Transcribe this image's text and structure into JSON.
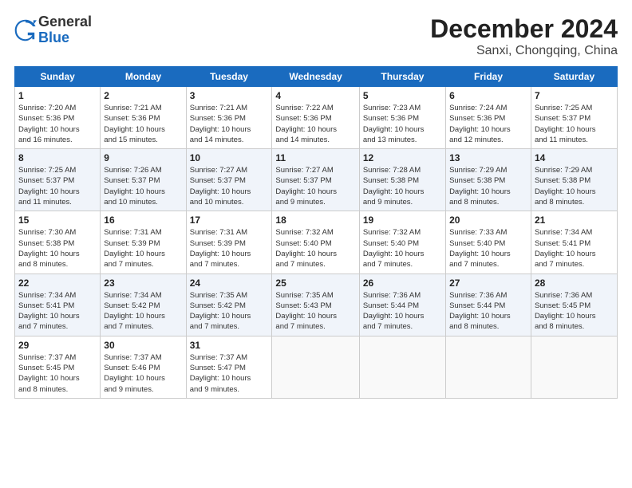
{
  "header": {
    "logo_general": "General",
    "logo_blue": "Blue",
    "main_title": "December 2024",
    "subtitle": "Sanxi, Chongqing, China"
  },
  "weekdays": [
    "Sunday",
    "Monday",
    "Tuesday",
    "Wednesday",
    "Thursday",
    "Friday",
    "Saturday"
  ],
  "weeks": [
    [
      {
        "day": "1",
        "info": "Sunrise: 7:20 AM\nSunset: 5:36 PM\nDaylight: 10 hours\nand 16 minutes."
      },
      {
        "day": "2",
        "info": "Sunrise: 7:21 AM\nSunset: 5:36 PM\nDaylight: 10 hours\nand 15 minutes."
      },
      {
        "day": "3",
        "info": "Sunrise: 7:21 AM\nSunset: 5:36 PM\nDaylight: 10 hours\nand 14 minutes."
      },
      {
        "day": "4",
        "info": "Sunrise: 7:22 AM\nSunset: 5:36 PM\nDaylight: 10 hours\nand 14 minutes."
      },
      {
        "day": "5",
        "info": "Sunrise: 7:23 AM\nSunset: 5:36 PM\nDaylight: 10 hours\nand 13 minutes."
      },
      {
        "day": "6",
        "info": "Sunrise: 7:24 AM\nSunset: 5:36 PM\nDaylight: 10 hours\nand 12 minutes."
      },
      {
        "day": "7",
        "info": "Sunrise: 7:25 AM\nSunset: 5:37 PM\nDaylight: 10 hours\nand 11 minutes."
      }
    ],
    [
      {
        "day": "8",
        "info": "Sunrise: 7:25 AM\nSunset: 5:37 PM\nDaylight: 10 hours\nand 11 minutes."
      },
      {
        "day": "9",
        "info": "Sunrise: 7:26 AM\nSunset: 5:37 PM\nDaylight: 10 hours\nand 10 minutes."
      },
      {
        "day": "10",
        "info": "Sunrise: 7:27 AM\nSunset: 5:37 PM\nDaylight: 10 hours\nand 10 minutes."
      },
      {
        "day": "11",
        "info": "Sunrise: 7:27 AM\nSunset: 5:37 PM\nDaylight: 10 hours\nand 9 minutes."
      },
      {
        "day": "12",
        "info": "Sunrise: 7:28 AM\nSunset: 5:38 PM\nDaylight: 10 hours\nand 9 minutes."
      },
      {
        "day": "13",
        "info": "Sunrise: 7:29 AM\nSunset: 5:38 PM\nDaylight: 10 hours\nand 8 minutes."
      },
      {
        "day": "14",
        "info": "Sunrise: 7:29 AM\nSunset: 5:38 PM\nDaylight: 10 hours\nand 8 minutes."
      }
    ],
    [
      {
        "day": "15",
        "info": "Sunrise: 7:30 AM\nSunset: 5:38 PM\nDaylight: 10 hours\nand 8 minutes."
      },
      {
        "day": "16",
        "info": "Sunrise: 7:31 AM\nSunset: 5:39 PM\nDaylight: 10 hours\nand 7 minutes."
      },
      {
        "day": "17",
        "info": "Sunrise: 7:31 AM\nSunset: 5:39 PM\nDaylight: 10 hours\nand 7 minutes."
      },
      {
        "day": "18",
        "info": "Sunrise: 7:32 AM\nSunset: 5:40 PM\nDaylight: 10 hours\nand 7 minutes."
      },
      {
        "day": "19",
        "info": "Sunrise: 7:32 AM\nSunset: 5:40 PM\nDaylight: 10 hours\nand 7 minutes."
      },
      {
        "day": "20",
        "info": "Sunrise: 7:33 AM\nSunset: 5:40 PM\nDaylight: 10 hours\nand 7 minutes."
      },
      {
        "day": "21",
        "info": "Sunrise: 7:34 AM\nSunset: 5:41 PM\nDaylight: 10 hours\nand 7 minutes."
      }
    ],
    [
      {
        "day": "22",
        "info": "Sunrise: 7:34 AM\nSunset: 5:41 PM\nDaylight: 10 hours\nand 7 minutes."
      },
      {
        "day": "23",
        "info": "Sunrise: 7:34 AM\nSunset: 5:42 PM\nDaylight: 10 hours\nand 7 minutes."
      },
      {
        "day": "24",
        "info": "Sunrise: 7:35 AM\nSunset: 5:42 PM\nDaylight: 10 hours\nand 7 minutes."
      },
      {
        "day": "25",
        "info": "Sunrise: 7:35 AM\nSunset: 5:43 PM\nDaylight: 10 hours\nand 7 minutes."
      },
      {
        "day": "26",
        "info": "Sunrise: 7:36 AM\nSunset: 5:44 PM\nDaylight: 10 hours\nand 7 minutes."
      },
      {
        "day": "27",
        "info": "Sunrise: 7:36 AM\nSunset: 5:44 PM\nDaylight: 10 hours\nand 8 minutes."
      },
      {
        "day": "28",
        "info": "Sunrise: 7:36 AM\nSunset: 5:45 PM\nDaylight: 10 hours\nand 8 minutes."
      }
    ],
    [
      {
        "day": "29",
        "info": "Sunrise: 7:37 AM\nSunset: 5:45 PM\nDaylight: 10 hours\nand 8 minutes."
      },
      {
        "day": "30",
        "info": "Sunrise: 7:37 AM\nSunset: 5:46 PM\nDaylight: 10 hours\nand 9 minutes."
      },
      {
        "day": "31",
        "info": "Sunrise: 7:37 AM\nSunset: 5:47 PM\nDaylight: 10 hours\nand 9 minutes."
      },
      {
        "day": "",
        "info": ""
      },
      {
        "day": "",
        "info": ""
      },
      {
        "day": "",
        "info": ""
      },
      {
        "day": "",
        "info": ""
      }
    ]
  ]
}
